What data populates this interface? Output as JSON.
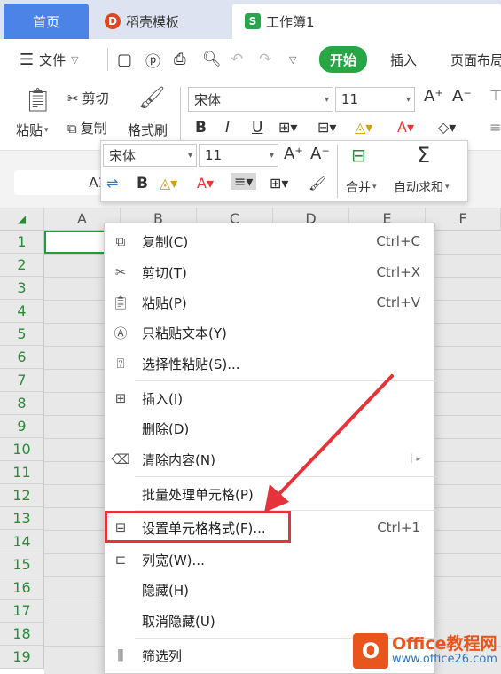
{
  "tabs": {
    "home": "首页",
    "template": "稻壳模板",
    "workbook": "工作簿1"
  },
  "menu": {
    "file": "文件",
    "start": "开始",
    "insert": "插入",
    "page_layout": "页面布局"
  },
  "ribbon": {
    "paste": "粘贴",
    "cut": "剪切",
    "copy": "复制",
    "format_painter": "格式刷",
    "font_name": "宋体",
    "font_size": "11",
    "bold": "B",
    "italic": "I",
    "underline": "U"
  },
  "formula_bar": {
    "name_box": "A1"
  },
  "mini_toolbar": {
    "font_name": "宋体",
    "font_size": "11",
    "merge": "合并",
    "autosum": "自动求和",
    "bold": "B"
  },
  "columns": [
    "A",
    "B",
    "C",
    "D",
    "E",
    "F"
  ],
  "rows": [
    "1",
    "2",
    "3",
    "4",
    "5",
    "6",
    "7",
    "8",
    "9",
    "10",
    "11",
    "12",
    "13",
    "14",
    "15",
    "16",
    "17",
    "18",
    "19"
  ],
  "context_menu": [
    {
      "icon": "copy-icon",
      "label": "复制(C)",
      "shortcut": "Ctrl+C"
    },
    {
      "icon": "scissors-icon",
      "label": "剪切(T)",
      "shortcut": "Ctrl+X"
    },
    {
      "icon": "paste-icon",
      "label": "粘贴(P)",
      "shortcut": "Ctrl+V"
    },
    {
      "icon": "paste-text-icon",
      "label": "只粘贴文本(Y)",
      "shortcut": ""
    },
    {
      "icon": "paste-special-icon",
      "label": "选择性粘贴(S)...",
      "shortcut": ""
    },
    {
      "icon": "insert-icon",
      "label": "插入(I)",
      "shortcut": ""
    },
    {
      "icon": "",
      "label": "删除(D)",
      "shortcut": ""
    },
    {
      "icon": "eraser-icon",
      "label": "清除内容(N)",
      "shortcut": ""
    },
    {
      "icon": "",
      "label": "批量处理单元格(P)",
      "shortcut": ""
    },
    {
      "icon": "format-cells-icon",
      "label": "设置单元格格式(F)...",
      "shortcut": "Ctrl+1"
    },
    {
      "icon": "column-width-icon",
      "label": "列宽(W)...",
      "shortcut": ""
    },
    {
      "icon": "",
      "label": "隐藏(H)",
      "shortcut": ""
    },
    {
      "icon": "",
      "label": "取消隐藏(U)",
      "shortcut": ""
    },
    {
      "icon": "filter-column-icon",
      "label": "筛选列",
      "shortcut": ""
    }
  ],
  "watermark": {
    "brand": "Office教程网",
    "url": "www.office26.com",
    "logo_letter": "O"
  },
  "colors": {
    "accent_green": "#27a645",
    "tab_blue": "#4c83e6",
    "highlight_red": "#e5333a",
    "arrow_red": "#e5333a"
  }
}
